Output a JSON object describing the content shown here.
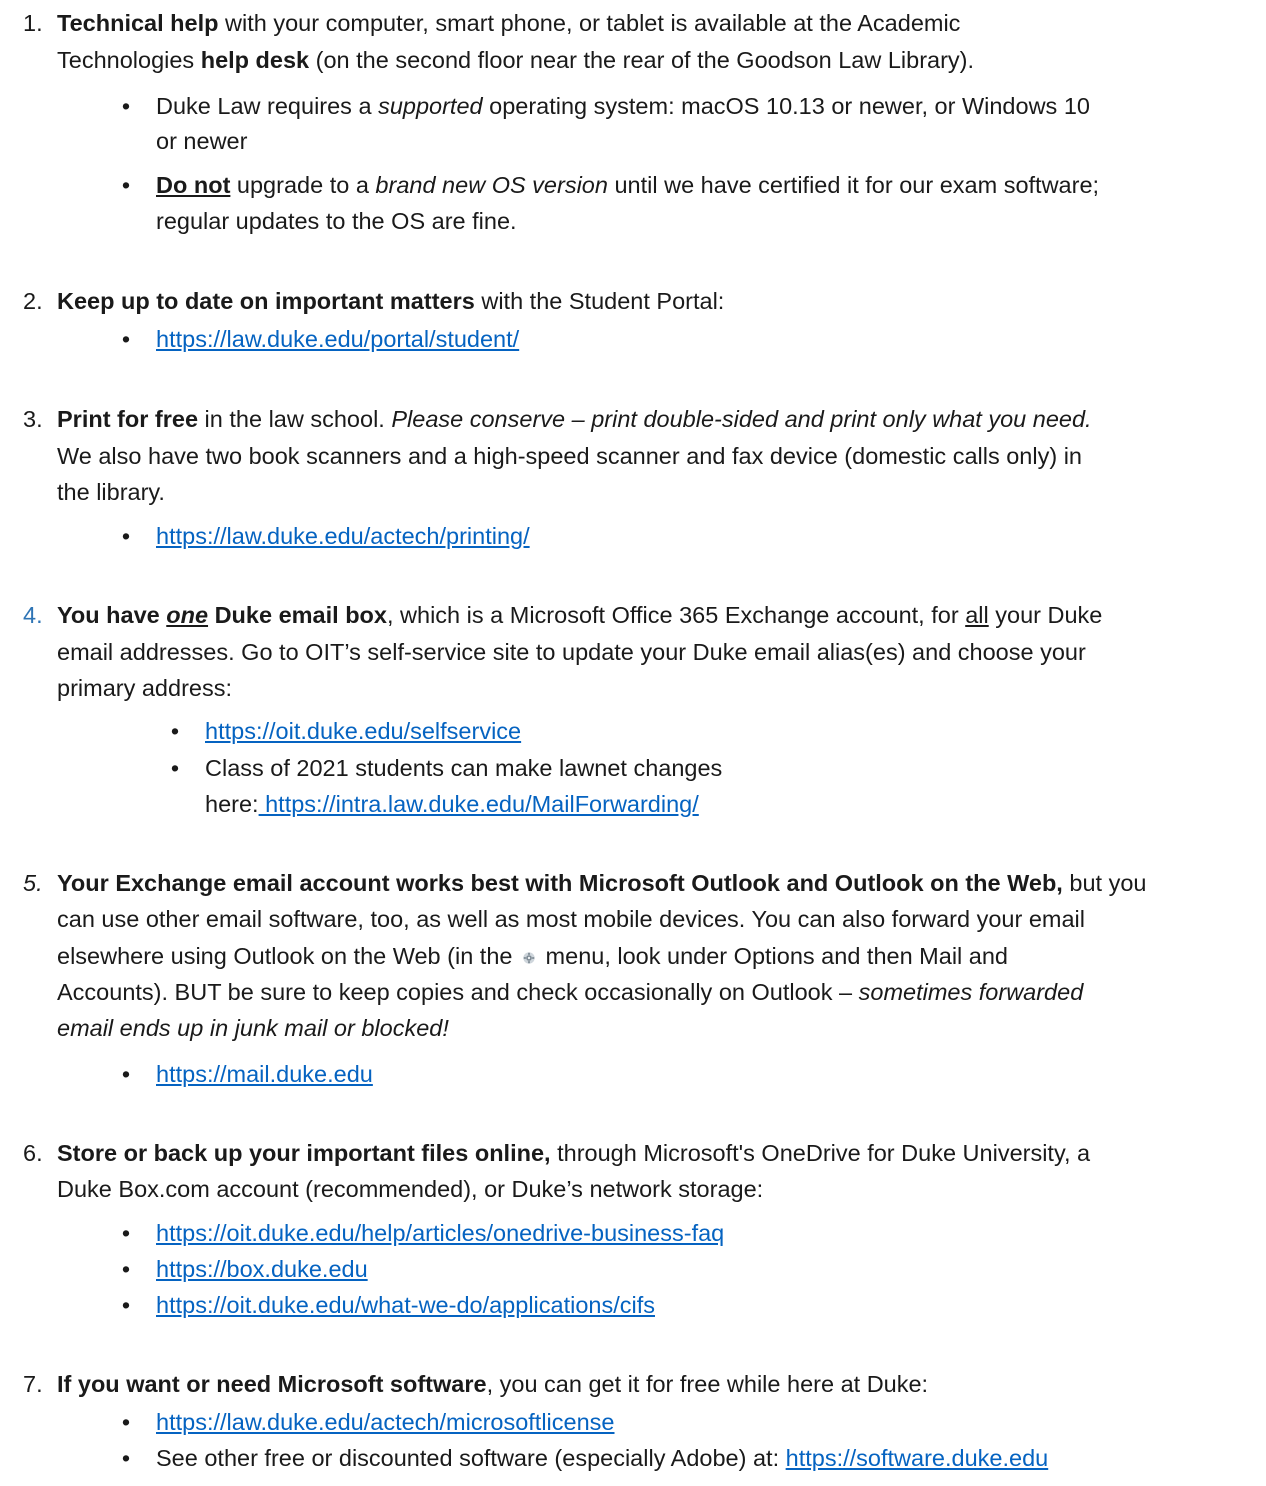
{
  "items": [
    {
      "num": "1.",
      "lines": [
        [
          {
            "t": "Technical help",
            "b": true
          },
          {
            "t": " with your computer, smart phone, or tablet is available at the Academic"
          }
        ],
        [
          {
            "t": "Technologies "
          },
          {
            "t": "help desk",
            "b": true
          },
          {
            "t": " (on the second floor near the rear of the Goodson Law Library)."
          }
        ]
      ],
      "bullets": [
        {
          "lines": [
            [
              {
                "t": "Duke Law requires a "
              },
              {
                "t": "supported",
                "i": true
              },
              {
                "t": " operating system: macOS 10.13 or newer, or Windows 10"
              }
            ],
            [
              {
                "t": "or newer"
              }
            ]
          ]
        },
        {
          "lines": [
            [
              {
                "t": "Do not",
                "b": true,
                "u": true
              },
              {
                "t": " upgrade to a "
              },
              {
                "t": "brand new OS version",
                "i": true
              },
              {
                "t": " until we have certified it for our exam software;"
              }
            ],
            [
              {
                "t": "regular updates to the OS are fine."
              }
            ]
          ]
        }
      ]
    },
    {
      "num": "2.",
      "lines": [
        [
          {
            "t": "Keep up to date on important matters",
            "b": true
          },
          {
            "t": " with the Student Portal:"
          }
        ]
      ],
      "bullets": [
        {
          "lines": [
            [
              {
                "t": "https://law.duke.edu/portal/student/",
                "link": true
              }
            ]
          ]
        }
      ]
    },
    {
      "num": "3.",
      "lines": [
        [
          {
            "t": "Print for free",
            "b": true
          },
          {
            "t": " in the law school. "
          },
          {
            "t": "Please conserve – print double-sided and print only what you need.",
            "i": true
          }
        ],
        [
          {
            "t": "We also have two book scanners and a high-speed scanner and fax device (domestic calls only) in"
          }
        ],
        [
          {
            "t": "the library."
          }
        ]
      ],
      "bullets": [
        {
          "lines": [
            [
              {
                "t": "https://law.duke.edu/actech/printing/",
                "link": true
              }
            ]
          ]
        }
      ]
    },
    {
      "num": "4.",
      "lines": [
        [
          {
            "t": "You have ",
            "b": true
          },
          {
            "t": "one",
            "b": true,
            "i": true,
            "u": true
          },
          {
            "t": " Duke email box",
            "b": true
          },
          {
            "t": ", which is a Microsoft Office 365 Exchange account, for "
          },
          {
            "t": "all",
            "u": true
          },
          {
            "t": " your Duke"
          }
        ],
        [
          {
            "t": "email addresses. Go to OIT’s self-service site to update your Duke email alias(es) and choose your"
          }
        ],
        [
          {
            "t": "primary address:"
          }
        ]
      ],
      "bullets": [
        {
          "lines": [
            [
              {
                "t": "https://oit.duke.edu/selfservice",
                "link": true
              }
            ]
          ]
        },
        {
          "lines": [
            [
              {
                "t": "Class of 2021 students can make lawnet changes"
              }
            ],
            [
              {
                "t": "here:"
              },
              {
                "t": " https://intra.law.duke.edu/MailForwarding/",
                "link": true
              }
            ]
          ]
        }
      ]
    },
    {
      "num": "5.",
      "lines": [
        [
          {
            "t": "Your Exchange email account works best with Microsoft Outlook and Outlook on the Web,",
            "b": true
          },
          {
            "t": " but you"
          }
        ],
        [
          {
            "t": "can use other email software, too, as well as most mobile devices. You can also forward your email"
          }
        ],
        [
          {
            "t": "elsewhere using Outlook on the Web (in the "
          },
          {
            "t": "",
            "gear": true
          },
          {
            "t": " menu, look under Options and then Mail and"
          }
        ],
        [
          {
            "t": "Accounts). BUT be sure to keep copies and check occasionally on Outlook – "
          },
          {
            "t": "sometimes forwarded",
            "i": true
          }
        ],
        [
          {
            "t": "email ends up in junk mail or blocked!",
            "i": true
          }
        ]
      ],
      "bullets": [
        {
          "lines": [
            [
              {
                "t": "https://mail.duke.edu",
                "link": true
              }
            ]
          ]
        }
      ]
    },
    {
      "num": "6.",
      "lines": [
        [
          {
            "t": "Store or back up your important files online,",
            "b": true
          },
          {
            "t": " through Microsoft's OneDrive for Duke University, a"
          }
        ],
        [
          {
            "t": "Duke Box.com account (recommended), or Duke’s network storage:"
          }
        ]
      ],
      "bullets": [
        {
          "lines": [
            [
              {
                "t": "https://oit.duke.edu/help/articles/onedrive-business-faq",
                "link": true
              }
            ]
          ]
        },
        {
          "lines": [
            [
              {
                "t": "https://box.duke.edu",
                "link": true
              }
            ]
          ]
        },
        {
          "lines": [
            [
              {
                "t": "https://oit.duke.edu/what-we-do/applications/cifs",
                "link": true
              }
            ]
          ]
        }
      ]
    },
    {
      "num": "7.",
      "lines": [
        [
          {
            "t": "If you want or need Microsoft software",
            "b": true
          },
          {
            "t": ", you can get it for free while here at Duke:"
          }
        ]
      ],
      "bullets": [
        {
          "lines": [
            [
              {
                "t": "https://law.duke.edu/actech/microsoftlicense",
                "link": true
              }
            ]
          ]
        },
        {
          "lines": [
            [
              {
                "t": "See other free or discounted software (especially Adobe) at: "
              },
              {
                "t": "https://software.duke.edu",
                "link": true
              }
            ]
          ]
        }
      ]
    }
  ],
  "bullet_char": "•",
  "colors": {
    "link": "#0563c1",
    "text": "#1a1a1a",
    "num4": "#2e74b5"
  }
}
